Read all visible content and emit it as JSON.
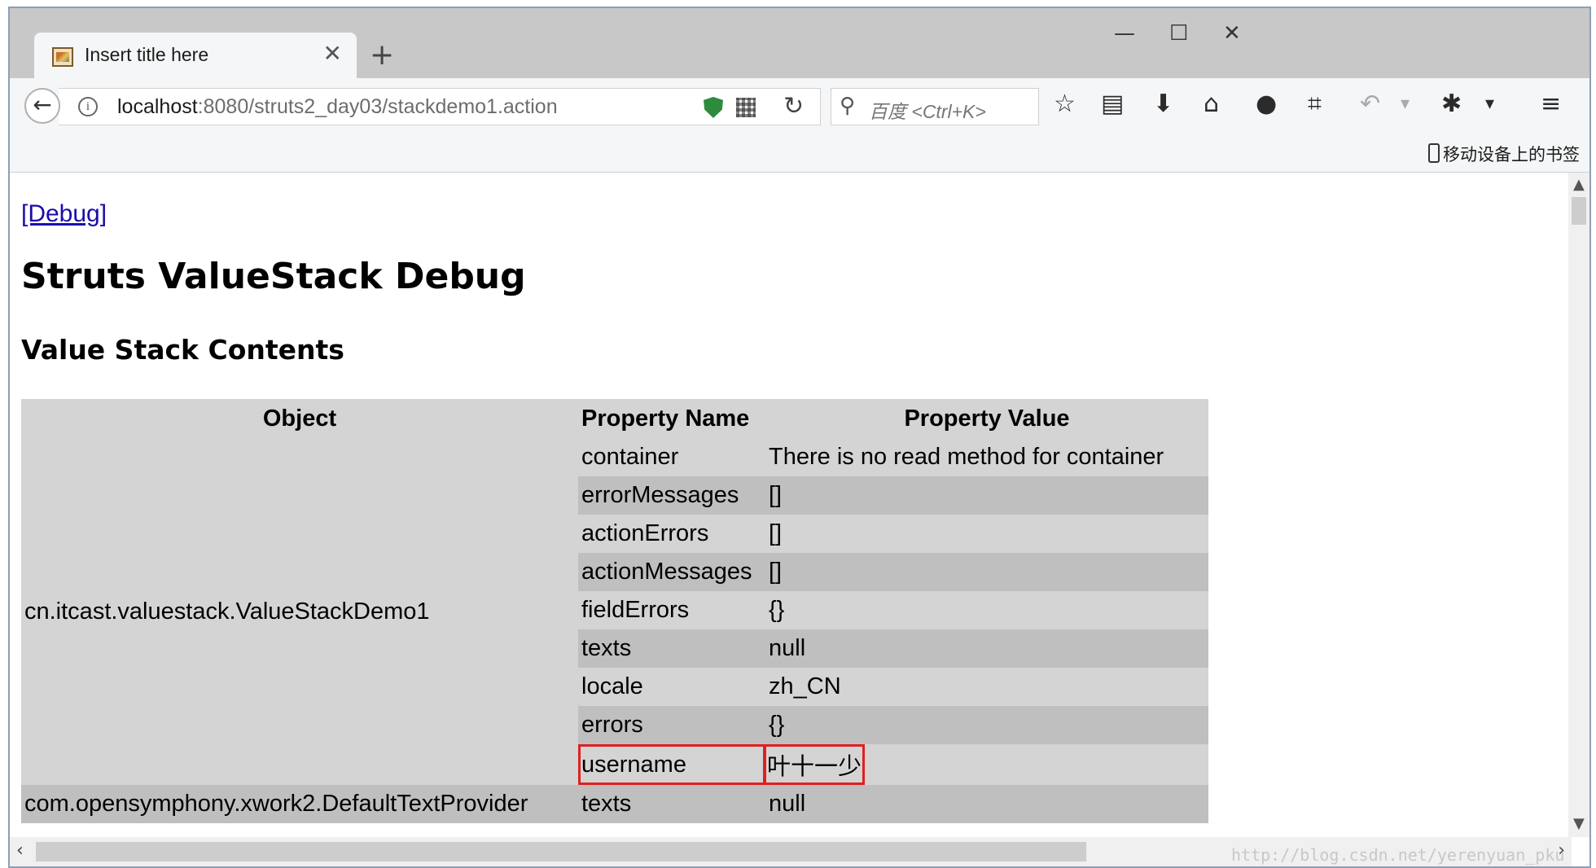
{
  "tab": {
    "title": "Insert title here",
    "close": "✕",
    "new_tab": "+"
  },
  "window_controls": {
    "minimize": "—",
    "maximize": "☐",
    "close": "✕"
  },
  "navbar": {
    "back": "←",
    "info": "i",
    "url_host": "localhost",
    "url_rest": ":8080/struts2_day03/stackdemo1.action",
    "reload": "↻",
    "search_icon": "⚲",
    "search_placeholder": "百度 <Ctrl+K>",
    "icons": {
      "bookmark_star": "☆",
      "reading_list": "▤",
      "download": "⬇",
      "home": "⌂",
      "chat": "●",
      "crop": "⌗",
      "undo": "↶",
      "dropdown": "▾",
      "extension": "✱",
      "menu": "≡"
    }
  },
  "bookmarks": {
    "mobile_label": "移动设备上的书签"
  },
  "page": {
    "debug_link": "[Debug]",
    "heading": "Struts ValueStack Debug",
    "subheading": "Value Stack Contents"
  },
  "table": {
    "headers": {
      "object": "Object",
      "property_name": "Property Name",
      "property_value": "Property Value"
    },
    "groups": [
      {
        "object": "cn.itcast.valuestack.ValueStackDemo1",
        "rows": [
          {
            "name": "container",
            "value": "There is no read method for container"
          },
          {
            "name": "errorMessages",
            "value": "[]"
          },
          {
            "name": "actionErrors",
            "value": "[]"
          },
          {
            "name": "actionMessages",
            "value": "[]"
          },
          {
            "name": "fieldErrors",
            "value": "{}"
          },
          {
            "name": "texts",
            "value": "null"
          },
          {
            "name": "locale",
            "value": "zh_CN"
          },
          {
            "name": "errors",
            "value": "{}"
          },
          {
            "name": "username",
            "value": "叶十一少"
          }
        ]
      },
      {
        "object": "com.opensymphony.xwork2.DefaultTextProvider",
        "rows": [
          {
            "name": "texts",
            "value": "null"
          }
        ]
      }
    ]
  },
  "scrollbars": {
    "up": "▲",
    "down": "▼",
    "left": "‹",
    "right": "›"
  },
  "watermark": "http://blog.csdn.net/yerenyuan_pku",
  "colors": {
    "link": "#1a0dab",
    "highlight_border": "#e02020",
    "row_light": "#d4d4d4",
    "row_dark": "#bfbfbf"
  }
}
